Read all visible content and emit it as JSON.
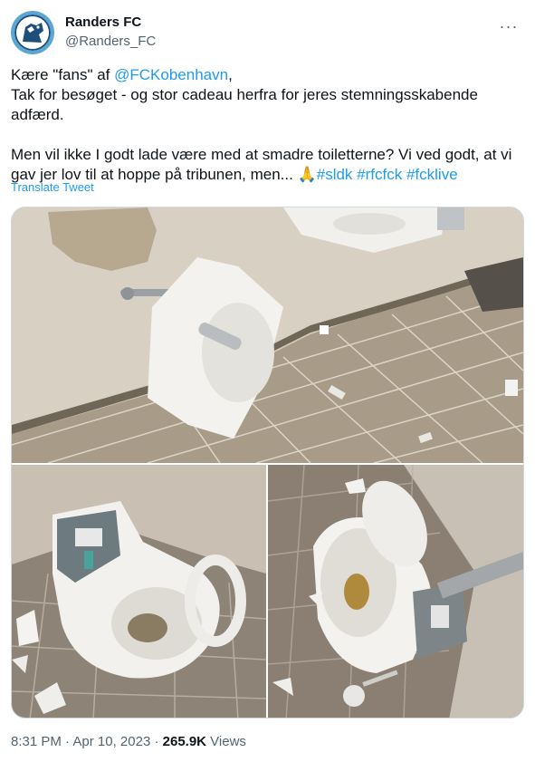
{
  "author": {
    "name": "Randers FC",
    "handle": "@Randers_FC",
    "avatar_color": "#5aa7d6"
  },
  "more_label": "···",
  "tweet": {
    "line1_prefix": "Kære \"fans\" af ",
    "line1_mention": "@FCKobenhavn",
    "line1_suffix": ",",
    "line2": "Tak for besøget - og stor cadeau herfra for jeres stemningsskabende",
    "line3": "adfærd.",
    "line4": "Men vil ikke I godt lade være med at smadre toiletterne? Vi ved godt, at vi",
    "line5_text": "gav jer lov til at hoppe på tribunen, men... 🙏",
    "hashtags": [
      "#sldk",
      "#rfcfck",
      "#fcklive"
    ]
  },
  "translate_label": "Translate Tweet",
  "meta": {
    "time": "8:31 PM",
    "separator1": " · ",
    "date": "Apr 10, 2023",
    "separator2": " · ",
    "views_count": "265.9K",
    "views_label": " Views"
  },
  "colors": {
    "link": "#1d9bf0",
    "secondary_text": "#536471",
    "primary_text": "#0f1419",
    "border": "#cfd9de"
  }
}
